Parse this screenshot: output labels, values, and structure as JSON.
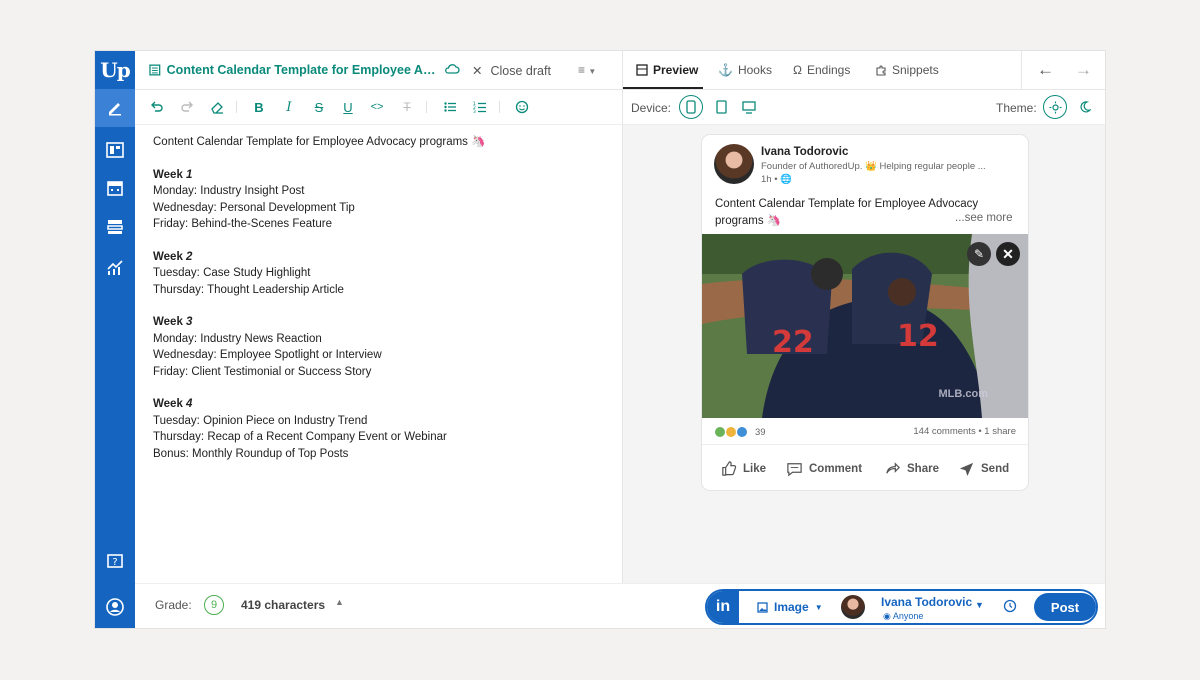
{
  "rail": {
    "logo": "Up",
    "items": [
      "edit-icon",
      "layout-icon",
      "calendar-icon",
      "library-icon",
      "analytics-icon"
    ],
    "bottom": [
      "help-icon",
      "user-icon"
    ]
  },
  "editor": {
    "doc_title": "Content Calendar Template for Employee Adv...",
    "close_draft": "Close draft",
    "menu_icon": "≡",
    "toolbar": [
      "undo-icon",
      "redo-icon",
      "eraser-icon",
      "bold-icon",
      "italic-icon",
      "strikethrough-icon",
      "underline-icon",
      "code-icon",
      "clear-format-icon",
      "bullet-list-icon",
      "numbered-list-icon",
      "emoji-icon"
    ],
    "title_line": "Content Calendar Template for Employee Advocacy programs 🦄",
    "weeks": [
      {
        "label": "Week ",
        "num": "1",
        "items": [
          "Monday: Industry Insight Post",
          "Wednesday: Personal Development Tip",
          "Friday: Behind-the-Scenes Feature"
        ]
      },
      {
        "label": "Week ",
        "num": "2",
        "items": [
          "Tuesday: Case Study Highlight",
          "Thursday: Thought Leadership Article"
        ]
      },
      {
        "label": "Week ",
        "num": "3",
        "items": [
          "Monday: Industry News Reaction",
          "Wednesday: Employee Spotlight or Interview",
          "Friday: Client Testimonial or Success Story"
        ]
      },
      {
        "label": "Week ",
        "num": "4",
        "items": [
          "Tuesday: Opinion Piece on Industry Trend",
          "Thursday: Recap of a Recent Company Event or Webinar",
          "Bonus: Monthly Roundup of Top Posts"
        ]
      }
    ]
  },
  "bottom": {
    "grade_label": "Grade:",
    "grade": "9",
    "characters": "419 characters",
    "network": "in",
    "media": "Image",
    "account_name": "Ivana Todorovic",
    "visibility": "Anyone",
    "post_label": "Post"
  },
  "preview": {
    "tabs": [
      {
        "label": "Preview",
        "icon": "preview-icon"
      },
      {
        "label": "Hooks",
        "icon": "anchor-icon"
      },
      {
        "label": "Endings",
        "icon": "magnet-icon"
      },
      {
        "label": "Snippets",
        "icon": "puzzle-icon"
      }
    ],
    "device_label": "Device:",
    "theme_label": "Theme:",
    "card": {
      "name": "Ivana Todorovic",
      "subtitle": "Founder of AuthoredUp. 👑 Helping regular people ...",
      "time": "1h •",
      "text": "Content Calendar Template for Employee Advocacy programs 🦄",
      "see_more": "...see more",
      "watermark": "MLB.com",
      "reactions": "39",
      "comments": "144 comments • 1 share",
      "actions": [
        "Like",
        "Comment",
        "Share",
        "Send"
      ]
    }
  },
  "colors": {
    "brand": "#1565c0",
    "accent": "#0a8a7a",
    "grade": "#4caf50"
  }
}
